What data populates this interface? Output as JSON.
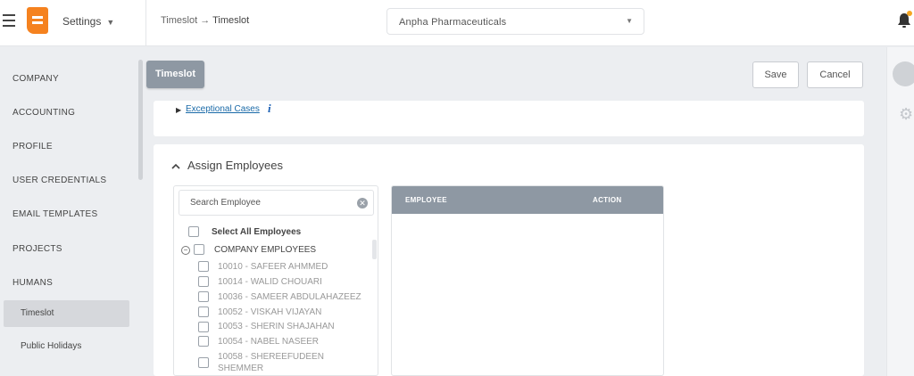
{
  "header": {
    "settings_label": "Settings",
    "breadcrumb_parent": "Timeslot",
    "breadcrumb_sep": " → ",
    "breadcrumb_current": "Timeslot",
    "company": "Anpha Pharmaceuticals",
    "accent_color": "#f5821f"
  },
  "sidebar": {
    "items": [
      {
        "label": "COMPANY"
      },
      {
        "label": "ACCOUNTING"
      },
      {
        "label": "PROFILE"
      },
      {
        "label": "USER CREDENTIALS"
      },
      {
        "label": "EMAIL TEMPLATES"
      },
      {
        "label": "PROJECTS"
      },
      {
        "label": "HUMANS"
      }
    ],
    "subitems": [
      {
        "label": "Timeslot",
        "active": true
      },
      {
        "label": "Public Holidays",
        "active": false
      }
    ]
  },
  "toolbar": {
    "tab_label": "Timeslot",
    "save_label": "Save",
    "cancel_label": "Cancel"
  },
  "exceptional": {
    "link_label": "Exceptional Cases",
    "info_glyph": "i"
  },
  "assign": {
    "title": "Assign Employees",
    "search_placeholder": "Search Employee",
    "select_all_label": "Select All Employees",
    "group_label": "COMPANY EMPLOYEES",
    "employees": [
      {
        "label": "10010 - SAFEER AHMMED"
      },
      {
        "label": "10014 - WALID CHOUARI"
      },
      {
        "label": "10036 - SAMEER ABDULAHAZEEZ"
      },
      {
        "label": "10052 - VISKAH VIJAYAN"
      },
      {
        "label": "10053 - SHERIN SHAJAHAN"
      },
      {
        "label": "10054 - NABEL NASEER"
      },
      {
        "label": "10058 - SHEREEFUDEEN SHEMMER"
      }
    ],
    "table_headers": {
      "employee": "EMPLOYEE",
      "action": "ACTION"
    }
  }
}
